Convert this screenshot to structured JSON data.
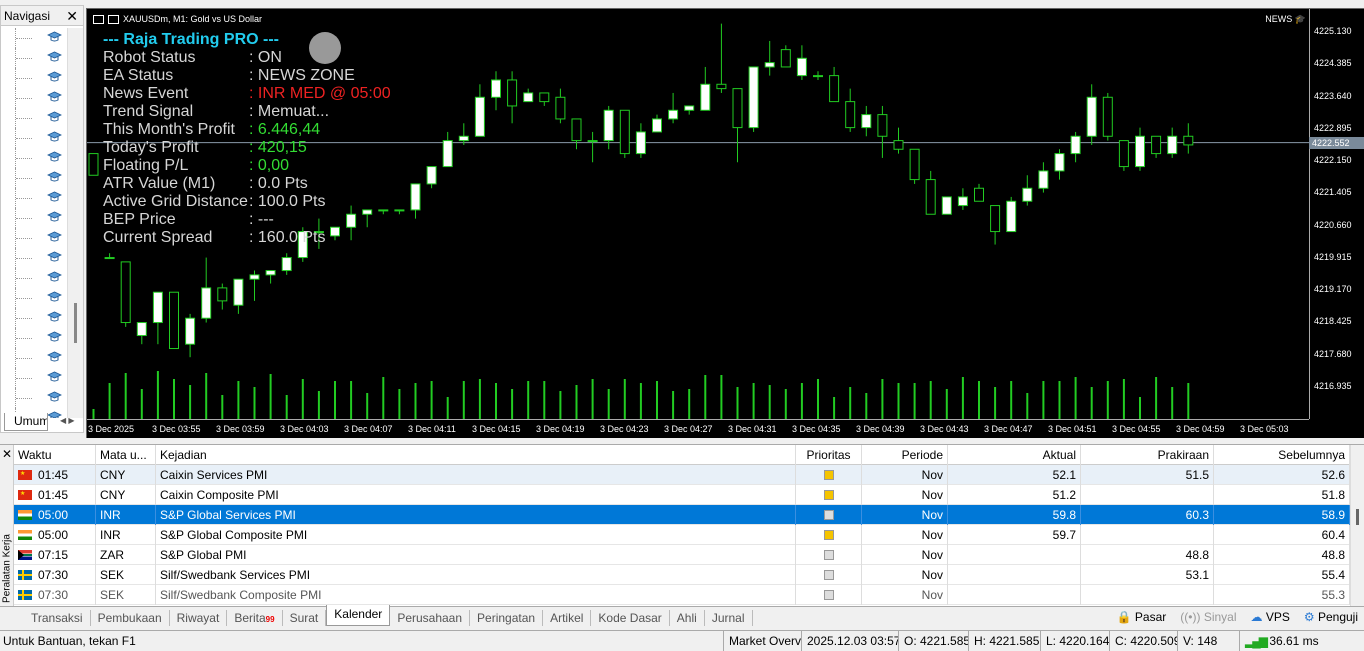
{
  "navigator": {
    "title": "Navigasi",
    "tab_label": "Umum"
  },
  "chart": {
    "title": "XAUUSDm, M1:  Gold vs US Dollar",
    "news_label": "NEWS",
    "current_price": "4222.552",
    "price_labels": [
      "4225.130",
      "4224.385",
      "4223.640",
      "4222.895",
      "4222.150",
      "4221.405",
      "4220.660",
      "4219.915",
      "4219.170",
      "4218.425",
      "4217.680",
      "4216.935"
    ],
    "time_labels": [
      "3 Dec 2025",
      "3 Dec 03:55",
      "3 Dec 03:59",
      "3 Dec 04:03",
      "3 Dec 04:07",
      "3 Dec 04:11",
      "3 Dec 04:15",
      "3 Dec 04:19",
      "3 Dec 04:23",
      "3 Dec 04:27",
      "3 Dec 04:31",
      "3 Dec 04:35",
      "3 Dec 04:39",
      "3 Dec 04:43",
      "3 Dec 04:47",
      "3 Dec 04:51",
      "3 Dec 04:55",
      "3 Dec 04:59",
      "3 Dec 05:03"
    ],
    "colors": {
      "bull": "#ffffff",
      "bear": "#000000",
      "wick": "#22cc22",
      "volume": "#22cc22",
      "level": "#8a9aaa"
    },
    "candles": [
      [
        4222.3,
        4222.3,
        4221.8,
        4221.8
      ],
      [
        4219.9,
        4220.0,
        4219.9,
        4219.9
      ],
      [
        4219.8,
        4219.8,
        4218.3,
        4218.4
      ],
      [
        4218.1,
        4218.4,
        4217.9,
        4218.4
      ],
      [
        4218.4,
        4219.1,
        4217.9,
        4219.1
      ],
      [
        4219.1,
        4219.1,
        4217.8,
        4217.8
      ],
      [
        4217.9,
        4218.6,
        4217.6,
        4218.5
      ],
      [
        4218.5,
        4219.9,
        4218.4,
        4219.2
      ],
      [
        4219.2,
        4219.3,
        4218.7,
        4218.9
      ],
      [
        4218.8,
        4219.4,
        4218.6,
        4219.4
      ],
      [
        4219.4,
        4219.6,
        4218.9,
        4219.5
      ],
      [
        4219.5,
        4219.6,
        4219.3,
        4219.6
      ],
      [
        4219.6,
        4220.0,
        4219.5,
        4219.9
      ],
      [
        4219.9,
        4220.6,
        4219.8,
        4220.5
      ],
      [
        4220.5,
        4220.8,
        4220.1,
        4220.5
      ],
      [
        4220.4,
        4220.6,
        4220.3,
        4220.6
      ],
      [
        4220.6,
        4221.1,
        4220.3,
        4220.9
      ],
      [
        4220.9,
        4221.0,
        4220.6,
        4221.0
      ],
      [
        4221.0,
        4221.0,
        4220.9,
        4221.0
      ],
      [
        4221.0,
        4221.0,
        4220.9,
        4221.0
      ],
      [
        4221.0,
        4221.6,
        4220.8,
        4221.6
      ],
      [
        4221.6,
        4222.0,
        4221.5,
        4222.0
      ],
      [
        4222.0,
        4222.8,
        4222.0,
        4222.6
      ],
      [
        4222.6,
        4223.0,
        4222.5,
        4222.7
      ],
      [
        4222.7,
        4223.9,
        4222.7,
        4223.6
      ],
      [
        4223.6,
        4224.2,
        4223.3,
        4224.0
      ],
      [
        4224.0,
        4224.2,
        4223.0,
        4223.4
      ],
      [
        4223.5,
        4223.8,
        4223.5,
        4223.7
      ],
      [
        4223.7,
        4223.7,
        4223.4,
        4223.5
      ],
      [
        4223.6,
        4223.8,
        4223.0,
        4223.1
      ],
      [
        4223.1,
        4223.0,
        4222.4,
        4222.6
      ],
      [
        4222.6,
        4222.8,
        4222.1,
        4222.6
      ],
      [
        4222.6,
        4223.4,
        4222.4,
        4223.3
      ],
      [
        4223.3,
        4223.3,
        4222.2,
        4222.3
      ],
      [
        4222.3,
        4223.0,
        4222.2,
        4222.8
      ],
      [
        4222.8,
        4223.2,
        4222.8,
        4223.1
      ],
      [
        4223.1,
        4223.7,
        4223.0,
        4223.3
      ],
      [
        4223.3,
        4223.4,
        4223.2,
        4223.4
      ],
      [
        4223.3,
        4224.3,
        4223.3,
        4223.9
      ],
      [
        4223.9,
        4225.3,
        4223.7,
        4223.8
      ],
      [
        4223.8,
        4223.8,
        4222.1,
        4222.9
      ],
      [
        4222.9,
        4224.3,
        4222.8,
        4224.3
      ],
      [
        4224.3,
        4224.9,
        4224.1,
        4224.4
      ],
      [
        4224.7,
        4224.8,
        4224.3,
        4224.3
      ],
      [
        4224.1,
        4224.8,
        4224.0,
        4224.5
      ],
      [
        4224.1,
        4224.2,
        4224.0,
        4224.1
      ],
      [
        4224.1,
        4224.3,
        4223.5,
        4223.5
      ],
      [
        4223.5,
        4223.8,
        4222.8,
        4222.9
      ],
      [
        4222.9,
        4223.4,
        4222.7,
        4223.2
      ],
      [
        4223.2,
        4223.4,
        4222.2,
        4222.7
      ],
      [
        4222.6,
        4222.9,
        4222.3,
        4222.4
      ],
      [
        4222.4,
        4222.4,
        4221.6,
        4221.7
      ],
      [
        4221.7,
        4221.9,
        4220.9,
        4220.9
      ],
      [
        4220.9,
        4221.3,
        4220.9,
        4221.3
      ],
      [
        4221.1,
        4221.5,
        4221.0,
        4221.3
      ],
      [
        4221.5,
        4221.6,
        4221.2,
        4221.2
      ],
      [
        4221.1,
        4221.1,
        4220.2,
        4220.5
      ],
      [
        4220.5,
        4221.3,
        4220.5,
        4221.2
      ],
      [
        4221.2,
        4221.8,
        4221.1,
        4221.5
      ],
      [
        4221.5,
        4222.1,
        4221.4,
        4221.9
      ],
      [
        4221.9,
        4222.4,
        4221.7,
        4222.3
      ],
      [
        4222.3,
        4222.8,
        4222.1,
        4222.7
      ],
      [
        4222.7,
        4223.9,
        4222.5,
        4223.6
      ],
      [
        4223.6,
        4223.7,
        4222.6,
        4222.7
      ],
      [
        4222.6,
        4222.4,
        4221.9,
        4222.0
      ],
      [
        4222.0,
        4222.9,
        4221.9,
        4222.7
      ],
      [
        4222.7,
        4222.7,
        4222.2,
        4222.3
      ],
      [
        4222.3,
        4222.9,
        4222.2,
        4222.7
      ],
      [
        4222.7,
        4223.0,
        4222.3,
        4222.5
      ]
    ],
    "volume": [
      10,
      36,
      46,
      30,
      48,
      40,
      34,
      46,
      24,
      38,
      32,
      45,
      24,
      40,
      28,
      38,
      38,
      26,
      42,
      30,
      36,
      38,
      22,
      38,
      40,
      36,
      30,
      38,
      38,
      28,
      34,
      40,
      30,
      40,
      36,
      38,
      28,
      30,
      44,
      44,
      32,
      36,
      34,
      30,
      36,
      40,
      22,
      32,
      26,
      40,
      36,
      36,
      38,
      30,
      42,
      38,
      32,
      38,
      26,
      38,
      38,
      42,
      32,
      38,
      40,
      22,
      42,
      32,
      36
    ]
  },
  "info_panel": {
    "header": "--- Raja Trading PRO ---",
    "rows": [
      {
        "label": "Robot Status",
        "value": ": ON",
        "color": "#d6d6d6"
      },
      {
        "label": "EA Status",
        "value": ": NEWS ZONE",
        "color": "#d6d6d6"
      },
      {
        "label": "News Event",
        "value": ": INR MED @ 05:00",
        "color": "#ee2222"
      },
      {
        "label": "Trend Signal",
        "value": ": Memuat...",
        "color": "#d6d6d6"
      },
      {
        "label": "This Month's Profit",
        "value": ": 6.446,44",
        "color": "#33dd33"
      },
      {
        "label": "Today's Profit",
        "value": ": 420,15",
        "color": "#33dd33"
      },
      {
        "label": "Floating P/L",
        "value": ": 0,00",
        "color": "#33dd33"
      },
      {
        "label": "ATR Value (M1)",
        "value": ": 0.0 Pts",
        "color": "#d6d6d6"
      },
      {
        "label": "Active Grid Distance",
        "value": ": 100.0 Pts",
        "color": "#d6d6d6"
      },
      {
        "label": "BEP Price",
        "value": ": ---",
        "color": "#d6d6d6"
      },
      {
        "label": "Current Spread",
        "value": ": 160.0 Pts",
        "color": "#d6d6d6"
      }
    ]
  },
  "calendar": {
    "columns": [
      "Waktu",
      "Mata u...",
      "Kejadian",
      "Prioritas",
      "Periode",
      "Aktual",
      "Prakiraan",
      "Sebelumnya"
    ],
    "rows": [
      {
        "time": "01:45",
        "flag": "cn",
        "currency": "CNY",
        "event": "Caixin Services PMI",
        "priority": "medium",
        "period": "Nov",
        "actual": "52.1",
        "forecast": "51.5",
        "previous": "52.6",
        "state": "hl"
      },
      {
        "time": "01:45",
        "flag": "cn",
        "currency": "CNY",
        "event": "Caixin Composite PMI",
        "priority": "medium",
        "period": "Nov",
        "actual": "51.2",
        "forecast": "",
        "previous": "51.8",
        "state": ""
      },
      {
        "time": "05:00",
        "flag": "in",
        "currency": "INR",
        "event": "S&P Global Services PMI",
        "priority": "low",
        "period": "Nov",
        "actual": "59.8",
        "forecast": "60.3",
        "previous": "58.9",
        "state": "sel"
      },
      {
        "time": "05:00",
        "flag": "in",
        "currency": "INR",
        "event": "S&P Global Composite PMI",
        "priority": "medium",
        "period": "Nov",
        "actual": "59.7",
        "forecast": "",
        "previous": "60.4",
        "state": ""
      },
      {
        "time": "07:15",
        "flag": "za",
        "currency": "ZAR",
        "event": "S&P Global PMI",
        "priority": "low",
        "period": "Nov",
        "actual": "",
        "forecast": "48.8",
        "previous": "48.8",
        "state": ""
      },
      {
        "time": "07:30",
        "flag": "se",
        "currency": "SEK",
        "event": "Silf/Swedbank Services PMI",
        "priority": "low",
        "period": "Nov",
        "actual": "",
        "forecast": "53.1",
        "previous": "55.4",
        "state": ""
      },
      {
        "time": "07:30",
        "flag": "se",
        "currency": "SEK",
        "event": "Silf/Swedbank Composite PMI",
        "priority": "low",
        "period": "Nov",
        "actual": "",
        "forecast": "",
        "previous": "55.3",
        "state": "dim"
      }
    ],
    "priority_colors": {
      "medium": "#f5c400",
      "low": "#dddddd"
    }
  },
  "side_label": "Peralatan Kerja",
  "tabs": [
    {
      "label": "Transaksi",
      "badge": ""
    },
    {
      "label": "Pembukaan",
      "badge": ""
    },
    {
      "label": "Riwayat",
      "badge": ""
    },
    {
      "label": "Berita",
      "badge": "99"
    },
    {
      "label": "Surat",
      "badge": ""
    },
    {
      "label": "Kalender",
      "badge": "",
      "active": true
    },
    {
      "label": "Perusahaan",
      "badge": ""
    },
    {
      "label": "Peringatan",
      "badge": ""
    },
    {
      "label": "Artikel",
      "badge": ""
    },
    {
      "label": "Kode Dasar",
      "badge": ""
    },
    {
      "label": "Ahli",
      "badge": ""
    },
    {
      "label": "Jurnal",
      "badge": ""
    }
  ],
  "right_tools": {
    "market": "Pasar",
    "signals": "Sinyal",
    "vps": "VPS",
    "tester": "Penguji"
  },
  "status_bar": {
    "help": "Untuk Bantuan, tekan F1",
    "profile": "Market Overv",
    "datetime": "2025.12.03 03:57",
    "open": "O: 4221.585",
    "high": "H: 4221.585",
    "low": "L: 4220.164",
    "close": "C: 4220.509",
    "volume": "V: 148",
    "ping": "36.61 ms"
  }
}
